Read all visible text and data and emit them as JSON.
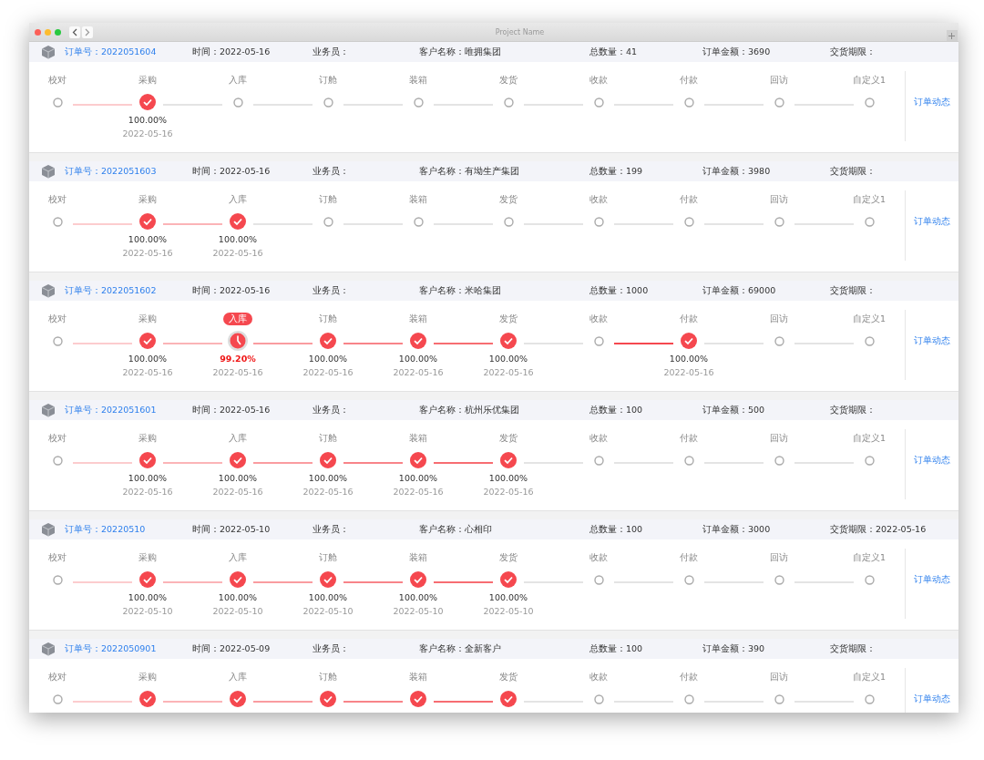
{
  "window": {
    "title": "Project Name"
  },
  "orders": [
    {
      "order_no": "订单号：2022051604",
      "time": "时间：2022-05-16",
      "salesperson": "业务员：",
      "customer": "客户名称：唯拥集团",
      "quantity": "总数量：41",
      "amount": "订单金额：3690",
      "deadline": "交货期限：",
      "link": "订单动态",
      "steps": [
        {
          "label": "校对",
          "kind": "pending"
        },
        {
          "label": "采购",
          "kind": "done",
          "percent": "100.00%",
          "date": "2022-05-16"
        },
        {
          "label": "入库",
          "kind": "pending"
        },
        {
          "label": "订舱",
          "kind": "pending"
        },
        {
          "label": "装箱",
          "kind": "pending"
        },
        {
          "label": "发货",
          "kind": "pending"
        },
        {
          "label": "收款",
          "kind": "pending"
        },
        {
          "label": "付款",
          "kind": "pending"
        },
        {
          "label": "回访",
          "kind": "pending"
        },
        {
          "label": "自定义1",
          "kind": "pending"
        }
      ]
    },
    {
      "order_no": "订单号：2022051603",
      "time": "时间：2022-05-16",
      "salesperson": "业务员：",
      "customer": "客户名称：有坳生产集团",
      "quantity": "总数量：199",
      "amount": "订单金额：3980",
      "deadline": "交货期限：",
      "link": "订单动态",
      "steps": [
        {
          "label": "校对",
          "kind": "pending"
        },
        {
          "label": "采购",
          "kind": "done",
          "percent": "100.00%",
          "date": "2022-05-16"
        },
        {
          "label": "入库",
          "kind": "done",
          "percent": "100.00%",
          "date": "2022-05-16"
        },
        {
          "label": "订舱",
          "kind": "pending"
        },
        {
          "label": "装箱",
          "kind": "pending"
        },
        {
          "label": "发货",
          "kind": "pending"
        },
        {
          "label": "收款",
          "kind": "pending"
        },
        {
          "label": "付款",
          "kind": "pending"
        },
        {
          "label": "回访",
          "kind": "pending"
        },
        {
          "label": "自定义1",
          "kind": "pending"
        }
      ]
    },
    {
      "order_no": "订单号：2022051602",
      "time": "时间：2022-05-16",
      "salesperson": "业务员：",
      "customer": "客户名称：米哈集团",
      "quantity": "总数量：1000",
      "amount": "订单金额：69000",
      "deadline": "交货期限：",
      "link": "订单动态",
      "steps": [
        {
          "label": "校对",
          "kind": "pending"
        },
        {
          "label": "采购",
          "kind": "done",
          "percent": "100.00%",
          "date": "2022-05-16"
        },
        {
          "label": "入库",
          "kind": "current",
          "percent": "99.20%",
          "date": "2022-05-16"
        },
        {
          "label": "订舱",
          "kind": "done",
          "percent": "100.00%",
          "date": "2022-05-16"
        },
        {
          "label": "装箱",
          "kind": "done",
          "percent": "100.00%",
          "date": "2022-05-16"
        },
        {
          "label": "发货",
          "kind": "done",
          "percent": "100.00%",
          "date": "2022-05-16"
        },
        {
          "label": "收款",
          "kind": "pending"
        },
        {
          "label": "付款",
          "kind": "done",
          "percent": "100.00%",
          "date": "2022-05-16"
        },
        {
          "label": "回访",
          "kind": "pending"
        },
        {
          "label": "自定义1",
          "kind": "pending"
        }
      ]
    },
    {
      "order_no": "订单号：2022051601",
      "time": "时间：2022-05-16",
      "salesperson": "业务员：",
      "customer": "客户名称：杭州乐优集团",
      "quantity": "总数量：100",
      "amount": "订单金额：500",
      "deadline": "交货期限：",
      "link": "订单动态",
      "steps": [
        {
          "label": "校对",
          "kind": "pending"
        },
        {
          "label": "采购",
          "kind": "done",
          "percent": "100.00%",
          "date": "2022-05-16"
        },
        {
          "label": "入库",
          "kind": "done",
          "percent": "100.00%",
          "date": "2022-05-16"
        },
        {
          "label": "订舱",
          "kind": "done",
          "percent": "100.00%",
          "date": "2022-05-16"
        },
        {
          "label": "装箱",
          "kind": "done",
          "percent": "100.00%",
          "date": "2022-05-16"
        },
        {
          "label": "发货",
          "kind": "done",
          "percent": "100.00%",
          "date": "2022-05-16"
        },
        {
          "label": "收款",
          "kind": "pending"
        },
        {
          "label": "付款",
          "kind": "pending"
        },
        {
          "label": "回访",
          "kind": "pending"
        },
        {
          "label": "自定义1",
          "kind": "pending"
        }
      ]
    },
    {
      "order_no": "订单号：20220510",
      "time": "时间：2022-05-10",
      "salesperson": "业务员：",
      "customer": "客户名称：心相印",
      "quantity": "总数量：100",
      "amount": "订单金额：3000",
      "deadline": "交货期限：2022-05-16",
      "link": "订单动态",
      "steps": [
        {
          "label": "校对",
          "kind": "pending"
        },
        {
          "label": "采购",
          "kind": "done",
          "percent": "100.00%",
          "date": "2022-05-10"
        },
        {
          "label": "入库",
          "kind": "done",
          "percent": "100.00%",
          "date": "2022-05-10"
        },
        {
          "label": "订舱",
          "kind": "done",
          "percent": "100.00%",
          "date": "2022-05-10"
        },
        {
          "label": "装箱",
          "kind": "done",
          "percent": "100.00%",
          "date": "2022-05-10"
        },
        {
          "label": "发货",
          "kind": "done",
          "percent": "100.00%",
          "date": "2022-05-10"
        },
        {
          "label": "收款",
          "kind": "pending"
        },
        {
          "label": "付款",
          "kind": "pending"
        },
        {
          "label": "回访",
          "kind": "pending"
        },
        {
          "label": "自定义1",
          "kind": "pending"
        }
      ]
    },
    {
      "order_no": "订单号：2022050901",
      "time": "时间：2022-05-09",
      "salesperson": "业务员：",
      "customer": "客户名称：全新客户",
      "quantity": "总数量：100",
      "amount": "订单金额：390",
      "deadline": "交货期限：",
      "link": "订单动态",
      "steps": [
        {
          "label": "校对",
          "kind": "pending"
        },
        {
          "label": "采购",
          "kind": "done"
        },
        {
          "label": "入库",
          "kind": "done"
        },
        {
          "label": "订舱",
          "kind": "done"
        },
        {
          "label": "装箱",
          "kind": "done"
        },
        {
          "label": "发货",
          "kind": "done"
        },
        {
          "label": "收款",
          "kind": "pending"
        },
        {
          "label": "付款",
          "kind": "pending"
        },
        {
          "label": "回访",
          "kind": "pending"
        },
        {
          "label": "自定义1",
          "kind": "pending"
        }
      ]
    }
  ]
}
